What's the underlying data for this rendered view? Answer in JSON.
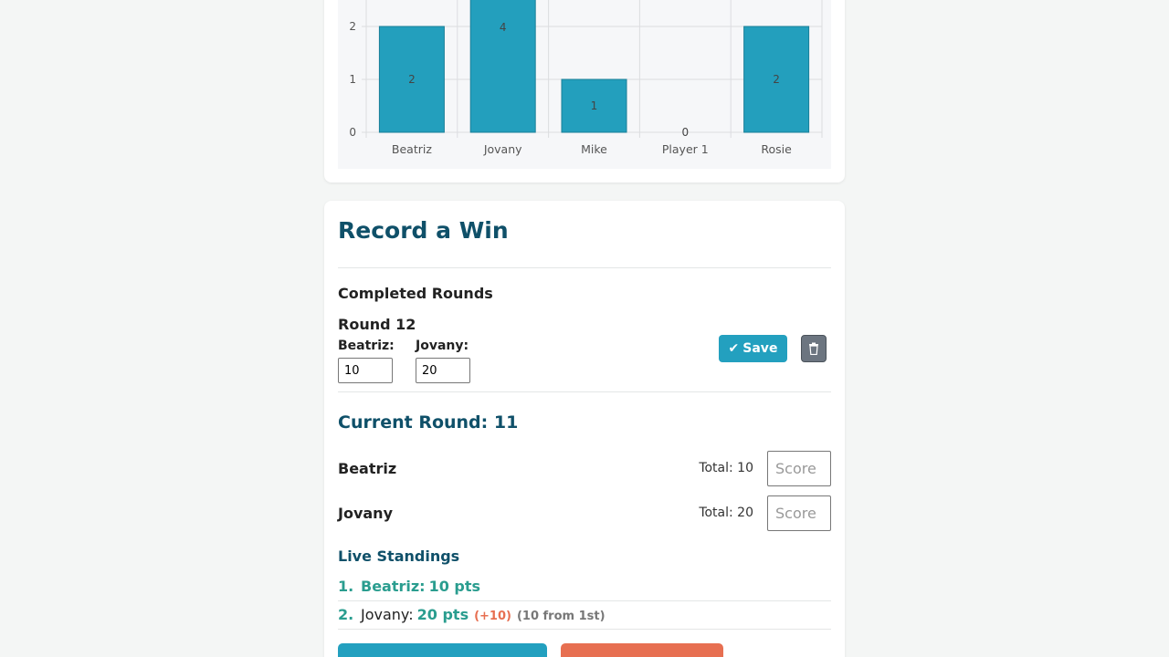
{
  "chart_data": {
    "type": "bar",
    "categories": [
      "Beatriz",
      "Jovany",
      "Mike",
      "Player 1",
      "Rosie"
    ],
    "values": [
      2,
      4,
      1,
      0,
      2
    ],
    "ytick_labels": [
      "0",
      "1",
      "2"
    ],
    "ylim": [
      0,
      2.5
    ],
    "grid": true,
    "colors": {
      "bar": "#239fbd",
      "bar_border": "#1a7f98",
      "grid": "#dcdde0",
      "axis_text": "#555555"
    }
  },
  "record": {
    "title": "Record a Win",
    "completed_heading": "Completed Rounds",
    "round_label": "Round 12",
    "entries": [
      {
        "name": "Beatriz:",
        "value": "10"
      },
      {
        "name": "Jovany:",
        "value": "20"
      }
    ],
    "save_label": "Save",
    "save_icon": "✔",
    "delete_icon": "trash-icon"
  },
  "current": {
    "label": "Current Round: 11",
    "players": [
      {
        "name": "Beatriz",
        "total": "Total: 10",
        "placeholder": "Score"
      },
      {
        "name": "Jovany",
        "total": "Total: 20",
        "placeholder": "Score"
      }
    ]
  },
  "standings": {
    "heading": "Live Standings",
    "rows": [
      {
        "rank": "1.",
        "name": "Beatriz:",
        "pts": "10 pts",
        "diff": "",
        "behind": ""
      },
      {
        "rank": "2.",
        "name": "Jovany:",
        "pts": "20 pts",
        "diff": "(+10)",
        "behind": "(10 from 1st)"
      }
    ]
  }
}
